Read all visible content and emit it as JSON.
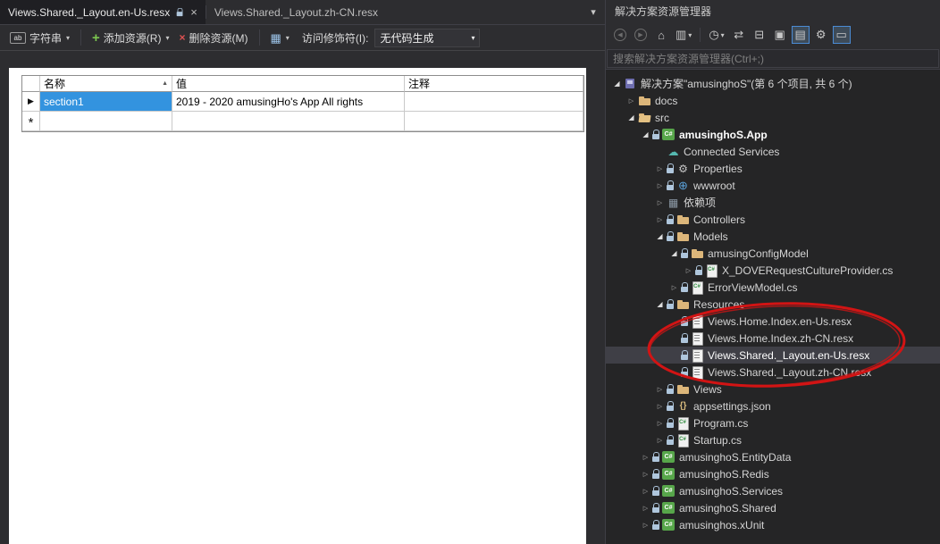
{
  "colors": {
    "selection_blue": "#3393DF",
    "tree_selection_gray": "#3F3F46",
    "annotation_red": "#D21414",
    "folder_yellow": "#DCB67A"
  },
  "icons": {
    "dropdown_chevron": "▾",
    "close": "×",
    "sort_ascending": "▲",
    "current_row_arrow": "▶",
    "new_row_star": "*",
    "string_type": "ab",
    "add_plus": "+",
    "delete_x": "×",
    "layout_grid": "▦",
    "document_list": "▾",
    "expanded_arrow": "◢",
    "collapsed_arrow": "▷"
  },
  "document_tabs": [
    {
      "label": "Views.Shared._Layout.en-Us.resx",
      "active": true,
      "locked": true
    },
    {
      "label": "Views.Shared._Layout.zh-CN.resx",
      "active": false
    }
  ],
  "resx_toolbar": {
    "resource_type": "字符串",
    "add_resource": "添加资源(R)",
    "delete_resource": "删除资源(M)",
    "access_modifier_label": "访问修饰符(I):",
    "access_modifier_value": "无代码生成"
  },
  "grid": {
    "columns": [
      "名称",
      "值",
      "注释"
    ],
    "rows": [
      {
        "name": "section1",
        "value": "2019 - 2020 amusingHo's App All rights",
        "comment": ""
      },
      {
        "name": "",
        "value": "",
        "comment": ""
      }
    ]
  },
  "solution_explorer": {
    "title": "解决方案资源管理器",
    "search_placeholder": "搜索解决方案资源管理器(Ctrl+;)",
    "toolbar_icons": [
      {
        "name": "back-icon",
        "glyph": "◀",
        "circle": true,
        "dim": true
      },
      {
        "name": "forward-icon",
        "glyph": "▶",
        "circle": true,
        "dim": true
      },
      {
        "name": "home-icon",
        "glyph": "⌂"
      },
      {
        "name": "filter-icon",
        "glyph": "▥",
        "dropdown": true
      },
      {
        "name": "separator"
      },
      {
        "name": "pending-changes-filter-icon",
        "glyph": "◷",
        "dropdown": true
      },
      {
        "name": "sync-with-active-document-icon",
        "glyph": "⇄"
      },
      {
        "name": "collapse-all-icon",
        "glyph": "⊟"
      },
      {
        "name": "properties-window-icon",
        "glyph": "▣"
      },
      {
        "name": "show-all-files-icon",
        "glyph": "▤",
        "boxed": true
      },
      {
        "name": "wrench-icon",
        "glyph": "⚙"
      },
      {
        "name": "preview-selected-items-icon",
        "glyph": "▭",
        "boxed": true
      }
    ],
    "tree": [
      {
        "label": "解决方案\"amusinghoS\"(第 6 个项目, 共 6 个)",
        "level": 0,
        "arrow": "expanded",
        "lock": false,
        "icon": "solution"
      },
      {
        "label": "docs",
        "level": 1,
        "arrow": "collapsed",
        "lock": false,
        "icon": "folder"
      },
      {
        "label": "src",
        "level": 1,
        "arrow": "expanded",
        "lock": false,
        "icon": "folder-open"
      },
      {
        "label": "amusinghoS.App",
        "level": 2,
        "arrow": "expanded",
        "lock": true,
        "icon": "project",
        "bold": true
      },
      {
        "label": "Connected Services",
        "level": 3,
        "arrow": "none",
        "lock": false,
        "icon": "connected"
      },
      {
        "label": "Properties",
        "level": 3,
        "arrow": "collapsed",
        "lock": true,
        "icon": "wrench"
      },
      {
        "label": "wwwroot",
        "level": 3,
        "arrow": "collapsed",
        "lock": true,
        "icon": "globe"
      },
      {
        "label": "依赖项",
        "level": 3,
        "arrow": "collapsed",
        "lock": false,
        "icon": "deps"
      },
      {
        "label": "Controllers",
        "level": 3,
        "arrow": "collapsed",
        "lock": true,
        "icon": "folder"
      },
      {
        "label": "Models",
        "level": 3,
        "arrow": "expanded",
        "lock": true,
        "icon": "folder"
      },
      {
        "label": "amusingConfigModel",
        "level": 4,
        "arrow": "expanded",
        "lock": true,
        "icon": "folder"
      },
      {
        "label": "X_DOVERequestCultureProvider.cs",
        "level": 5,
        "arrow": "collapsed",
        "lock": true,
        "icon": "csfile"
      },
      {
        "label": "ErrorViewModel.cs",
        "level": 4,
        "arrow": "collapsed",
        "lock": true,
        "icon": "csfile"
      },
      {
        "label": "Resources",
        "level": 3,
        "arrow": "expanded",
        "lock": true,
        "icon": "folder"
      },
      {
        "label": "Views.Home.Index.en-Us.resx",
        "level": 4,
        "arrow": "none",
        "lock": true,
        "icon": "resx"
      },
      {
        "label": "Views.Home.Index.zh-CN.resx",
        "level": 4,
        "arrow": "none",
        "lock": true,
        "icon": "resx"
      },
      {
        "label": "Views.Shared._Layout.en-Us.resx",
        "level": 4,
        "arrow": "none",
        "lock": true,
        "icon": "resx",
        "selected": true
      },
      {
        "label": "Views.Shared._Layout.zh-CN.resx",
        "level": 4,
        "arrow": "none",
        "lock": true,
        "icon": "resx"
      },
      {
        "label": "Views",
        "level": 3,
        "arrow": "collapsed",
        "lock": true,
        "icon": "folder"
      },
      {
        "label": "appsettings.json",
        "level": 3,
        "arrow": "collapsed",
        "lock": true,
        "icon": "json"
      },
      {
        "label": "Program.cs",
        "level": 3,
        "arrow": "collapsed",
        "lock": true,
        "icon": "csfile"
      },
      {
        "label": "Startup.cs",
        "level": 3,
        "arrow": "collapsed",
        "lock": true,
        "icon": "csfile"
      },
      {
        "label": "amusinghoS.EntityData",
        "level": 2,
        "arrow": "collapsed",
        "lock": true,
        "icon": "project"
      },
      {
        "label": "amusinghoS.Redis",
        "level": 2,
        "arrow": "collapsed",
        "lock": true,
        "icon": "project"
      },
      {
        "label": "amusinghoS.Services",
        "level": 2,
        "arrow": "collapsed",
        "lock": true,
        "icon": "project"
      },
      {
        "label": "amusinghoS.Shared",
        "level": 2,
        "arrow": "collapsed",
        "lock": true,
        "icon": "project"
      },
      {
        "label": "amusinghos.xUnit",
        "level": 2,
        "arrow": "collapsed",
        "lock": true,
        "icon": "project"
      }
    ]
  },
  "annotation": {
    "color": "#D21414"
  }
}
